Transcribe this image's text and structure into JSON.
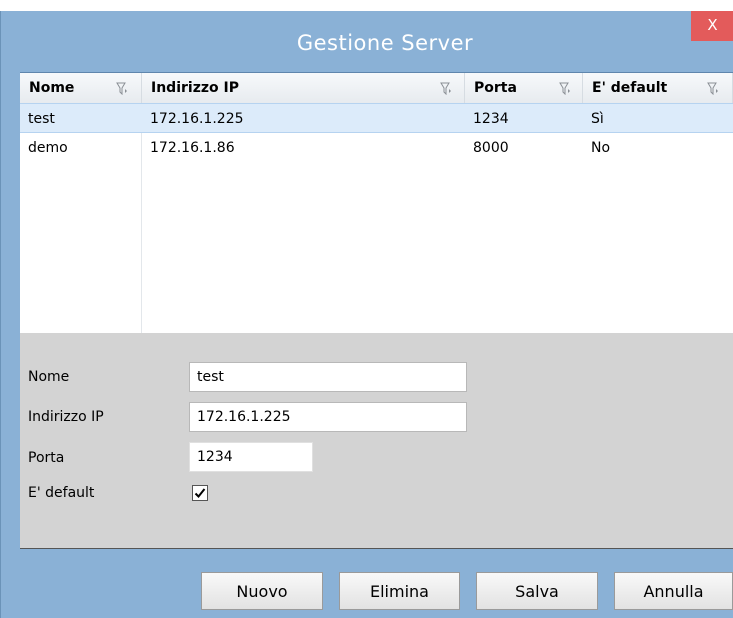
{
  "window": {
    "title": "Gestione Server",
    "close_label": "X"
  },
  "grid": {
    "columns": [
      "Nome",
      "Indirizzo IP",
      "Porta",
      "E' default"
    ],
    "rows": [
      [
        "test",
        "172.16.1.225",
        "1234",
        "Sì"
      ],
      [
        "demo",
        "172.16.1.86",
        "8000",
        "No"
      ]
    ],
    "selected_row": 0
  },
  "form": {
    "nome_label": "Nome",
    "nome_value": "test",
    "ip_label": "Indirizzo IP",
    "ip_value": "172.16.1.225",
    "porta_label": "Porta",
    "porta_value": "1234",
    "default_label": "E' default",
    "default_checked": true
  },
  "buttons": {
    "nuovo": "Nuovo",
    "elimina": "Elimina",
    "salva": "Salva",
    "annulla": "Annulla"
  },
  "colors": {
    "title_bg": "#8ab1d6",
    "close_bg": "#e35b5b",
    "selected_row": "#dcebfa",
    "form_bg": "#d3d3d3"
  }
}
